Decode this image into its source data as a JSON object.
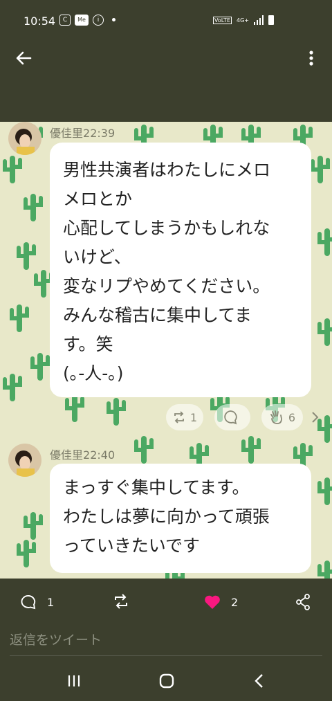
{
  "status_bar": {
    "time": "10:54",
    "network": "4G+",
    "volte": "VoLTE"
  },
  "tweet": {
    "messages": [
      {
        "sender": "優佳里",
        "time": "22:39",
        "lines": [
          "男性共演者はわたしにメロ",
          "メロとか",
          "心配してしまうかもしれな",
          "いけど、",
          "変なリプやめてください。",
          "みんな稽古に集中してま",
          "す。笑",
          "(｡-人-｡)"
        ],
        "reactions": {
          "repost_count": "1",
          "comment_count": "",
          "clap_count": "6"
        }
      },
      {
        "sender": "優佳里",
        "time": "22:40",
        "lines": [
          "まっすぐ集中してます。",
          "わたしは夢に向かって頑張",
          "っていきたいです"
        ]
      }
    ]
  },
  "actions": {
    "reply_count": "1",
    "retweet_count": "",
    "like_count": "2"
  },
  "reply": {
    "placeholder": "返信をツイート"
  },
  "colors": {
    "header_bg": "#3c3f2d",
    "chat_bg": "#e8e8c9",
    "cactus": "#4ba862",
    "heart": "#f91880"
  }
}
